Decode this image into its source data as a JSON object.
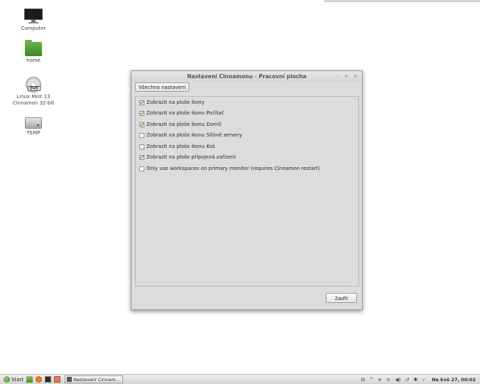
{
  "desktop": {
    "icons": [
      {
        "label": "Computer"
      },
      {
        "label": "home"
      },
      {
        "label_line1": "Linux Mint 13",
        "label_line2": "Cinnamon 32-bit",
        "disc_text": "DVD"
      },
      {
        "label": "TEMP"
      }
    ]
  },
  "window": {
    "title": "Nastavení Cinnamonu - Pracovní plocha",
    "controls": {
      "minimize": "–",
      "maximize": "+",
      "close": "×"
    },
    "all_settings_label": "Všechna nastavení",
    "options": [
      {
        "label": "Zobrazit na ploše ikony",
        "checked": true
      },
      {
        "label": "Zobrazit na ploše ikonu Počítač",
        "checked": true
      },
      {
        "label": "Zobrazit na ploše ikonu Domů",
        "checked": true
      },
      {
        "label": "Zobrazit na ploše ikonu Síťové servery",
        "checked": false
      },
      {
        "label": "Zobrazit na ploše ikonu Koš",
        "checked": false
      },
      {
        "label": "Zobrazit na ploše připojená zařízení",
        "checked": true
      },
      {
        "label": "Only use workspaces on primary monitor (requires Cinnamon restart)",
        "checked": false
      }
    ],
    "close_label": "Zavřít"
  },
  "taskbar": {
    "start_label": "Start",
    "task_label": "Nastavení Cinnam...",
    "tray": {
      "network": "⊟",
      "up": "^",
      "bluetooth": "∗",
      "wifi": "ᯤ",
      "volume": "◀)",
      "update": "↺",
      "shield": "✱",
      "check": "✓"
    },
    "clock": "Ne kvě 27, 00:02"
  },
  "colors": {
    "check_green": "#4f8c2a",
    "start_orb": "#2e7a3a"
  }
}
